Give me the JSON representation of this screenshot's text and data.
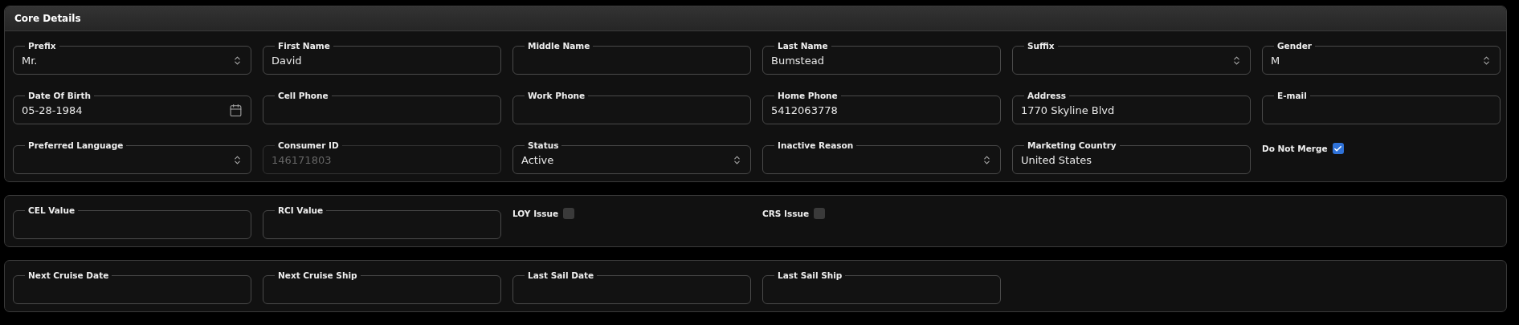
{
  "panels": [
    {
      "title": "Core Details",
      "fields": [
        {
          "kind": "select",
          "label": "Prefix",
          "value": "Mr.",
          "disabled": false
        },
        {
          "kind": "text",
          "label": "First Name",
          "value": "David",
          "disabled": false
        },
        {
          "kind": "text",
          "label": "Middle Name",
          "disabled": false
        },
        {
          "kind": "text",
          "label": "Last Name",
          "value": "Bumstead",
          "disabled": false
        },
        {
          "kind": "select",
          "label": "Suffix",
          "disabled": false
        },
        {
          "kind": "select",
          "label": "Gender",
          "value": "M",
          "disabled": false
        },
        {
          "kind": "date",
          "label": "Date Of Birth",
          "value": "05-28-1984",
          "disabled": false
        },
        {
          "kind": "text",
          "label": "Cell Phone",
          "disabled": false
        },
        {
          "kind": "text",
          "label": "Work Phone",
          "disabled": false
        },
        {
          "kind": "text",
          "label": "Home Phone",
          "value": "5412063778",
          "disabled": false
        },
        {
          "kind": "text",
          "label": "Address",
          "value": "1770 Skyline Blvd",
          "disabled": false
        },
        {
          "kind": "text",
          "label": "E-mail",
          "disabled": false
        },
        {
          "kind": "select",
          "label": "Preferred Language",
          "disabled": false
        },
        {
          "kind": "text",
          "label": "Consumer ID",
          "value": "146171803",
          "disabled": true
        },
        {
          "kind": "select",
          "label": "Status",
          "value": "Active",
          "disabled": false
        },
        {
          "kind": "select",
          "label": "Inactive Reason",
          "disabled": false
        },
        {
          "kind": "text",
          "label": "Marketing Country",
          "value": "United States",
          "disabled": false
        },
        {
          "kind": "checkbox",
          "label": "Do Not Merge",
          "checked": true
        }
      ]
    },
    {
      "fields": [
        {
          "kind": "text",
          "label": "CEL Value",
          "disabled": false
        },
        {
          "kind": "text",
          "label": "RCI Value",
          "disabled": false
        },
        {
          "kind": "checkbox",
          "label": "LOY Issue",
          "checked": false
        },
        {
          "kind": "checkbox",
          "label": "CRS Issue",
          "checked": false
        }
      ]
    },
    {
      "fields": [
        {
          "kind": "text",
          "label": "Next Cruise Date",
          "disabled": false
        },
        {
          "kind": "text",
          "label": "Next Cruise Ship",
          "disabled": false
        },
        {
          "kind": "text",
          "label": "Last Sail Date",
          "disabled": false
        },
        {
          "kind": "text",
          "label": "Last Sail Ship",
          "disabled": false
        }
      ]
    }
  ]
}
